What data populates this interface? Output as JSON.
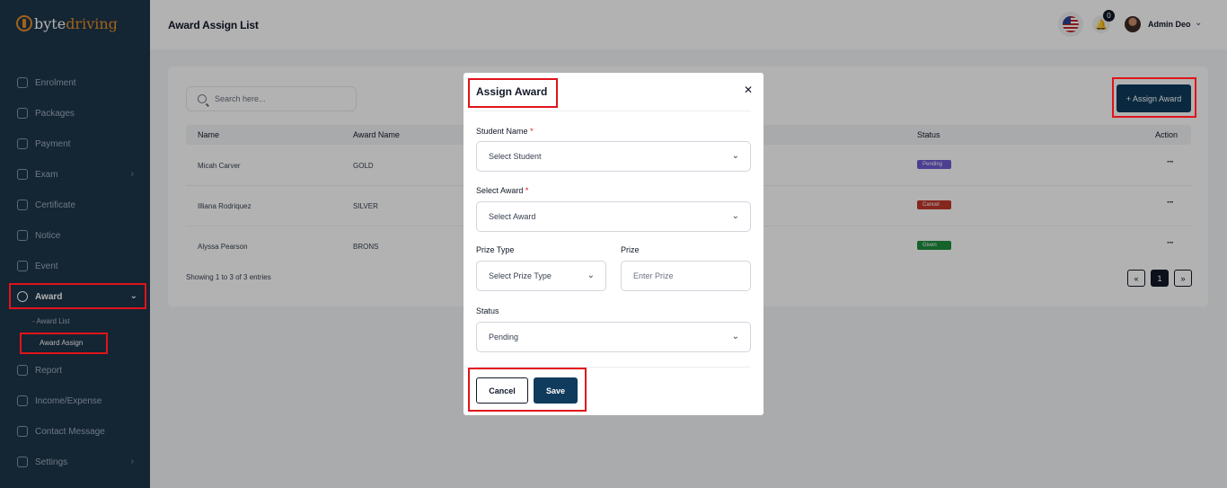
{
  "brand": {
    "part1": "byte",
    "part2": "driving"
  },
  "sidebar": {
    "items": [
      {
        "label": "Enrolment"
      },
      {
        "label": "Packages"
      },
      {
        "label": "Payment"
      },
      {
        "label": "Exam"
      },
      {
        "label": "Certificate"
      },
      {
        "label": "Notice"
      },
      {
        "label": "Event"
      },
      {
        "label": "Award"
      },
      {
        "label": "Report"
      },
      {
        "label": "Income/Expense"
      },
      {
        "label": "Contact Message"
      },
      {
        "label": "Settings"
      }
    ],
    "award_sub": [
      {
        "label": "- Award List"
      },
      {
        "label": "Award Assign"
      }
    ]
  },
  "header": {
    "title": "Award Assign List",
    "notification_count": "0",
    "user_name": "Admin Deo"
  },
  "list": {
    "search_placeholder": "Search here...",
    "assign_button": "+ Assign Award",
    "columns": {
      "name": "Name",
      "award_name": "Award Name",
      "status": "Status",
      "action": "Action"
    },
    "rows": [
      {
        "name": "Micah Carver",
        "award": "GOLD",
        "status": "Pending",
        "status_color": "#6d5bd0"
      },
      {
        "name": "Illiana Rodriquez",
        "award": "SILVER",
        "status": "Cancel",
        "status_color": "#c0392b"
      },
      {
        "name": "Alyssa Pearson",
        "award": "BRONS",
        "status": "Given",
        "status_color": "#1e8e3e"
      }
    ],
    "entries_text": "Showing 1 to 3 of 3 entries",
    "pagination": {
      "prev": "«",
      "current": "1",
      "next": "»"
    }
  },
  "modal": {
    "title": "Assign Award",
    "student_label": "Student Name",
    "student_value": "Select Student",
    "award_label": "Select Award",
    "award_value": "Select Award",
    "prize_type_label": "Prize Type",
    "prize_type_value": "Select Prize Type",
    "prize_label": "Prize",
    "prize_placeholder": "Enter Prize",
    "status_label": "Status",
    "status_value": "Pending",
    "cancel": "Cancel",
    "save": "Save",
    "required_mark": "*"
  },
  "colors": {
    "sidebar": "#1d3549",
    "primary": "#0f3b5c",
    "accent": "#e58e2a",
    "highlight": "#e0141b"
  }
}
